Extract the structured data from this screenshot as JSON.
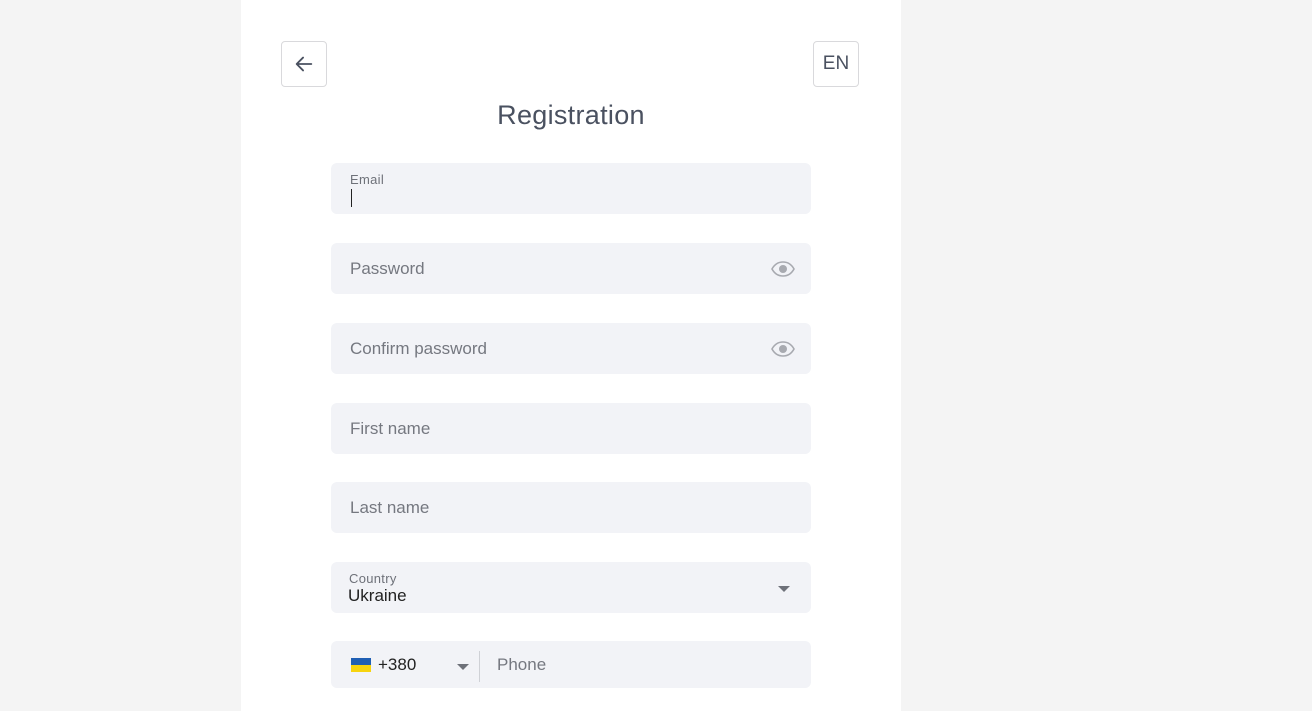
{
  "header": {
    "back_icon": "arrow-left-icon",
    "language": "EN",
    "title": "Registration"
  },
  "form": {
    "email": {
      "label": "Email",
      "value": ""
    },
    "password": {
      "placeholder": "Password",
      "toggle_icon": "eye-icon"
    },
    "confirm_password": {
      "placeholder": "Confirm password",
      "toggle_icon": "eye-icon"
    },
    "first_name": {
      "placeholder": "First name"
    },
    "last_name": {
      "placeholder": "Last name"
    },
    "country": {
      "label": "Country",
      "value": "Ukraine"
    },
    "phone": {
      "flag": "ukraine-flag",
      "prefix": "+380",
      "placeholder": "Phone"
    }
  },
  "colors": {
    "page_background": "#f4f4f4",
    "field_background": "#f2f3f7",
    "text_primary": "#4a5160",
    "flag_blue": "#1f5fb4",
    "flag_yellow": "#f7d40f"
  }
}
